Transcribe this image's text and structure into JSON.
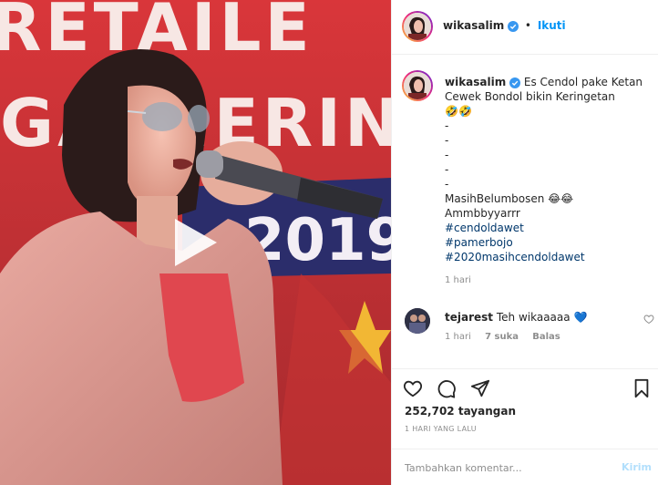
{
  "video": {
    "banner_text_top": "RETAILE",
    "banner_text_mid": "GATHERIN",
    "banner_year": "2019"
  },
  "header": {
    "username": "wikasalim",
    "separator": "•",
    "follow_label": "Ikuti"
  },
  "caption": {
    "username": "wikasalim",
    "line1": "Es Cendol pake Ketan",
    "line2": "Cewek Bondol bikin Keringetan",
    "line3": "🤣🤣",
    "dashes": [
      "-",
      "-",
      "-",
      "-",
      "-"
    ],
    "line4": "MasihBelumbosen 😂😂",
    "line5": "Ammbbyyarrr",
    "hashtags": [
      "#cendoldawet",
      "#pamerbojo",
      "#2020masihcendoldawet"
    ],
    "time": "1 hari"
  },
  "comment": {
    "username": "tejarest",
    "text": "Teh wikaaaaa",
    "emoji": "💙",
    "time": "1 hari",
    "likes": "7 suka",
    "reply_label": "Balas"
  },
  "stats": {
    "views": "252,702 tayangan",
    "posted_ago": "1 HARI YANG LALU"
  },
  "add_comment": {
    "placeholder": "Tambahkan komentar...",
    "post_label": "Kirim"
  },
  "colors": {
    "accent": "#0095f6",
    "hashtag": "#00376b",
    "muted": "#8e8e8e",
    "heart_blue": "#1f5fbf"
  }
}
